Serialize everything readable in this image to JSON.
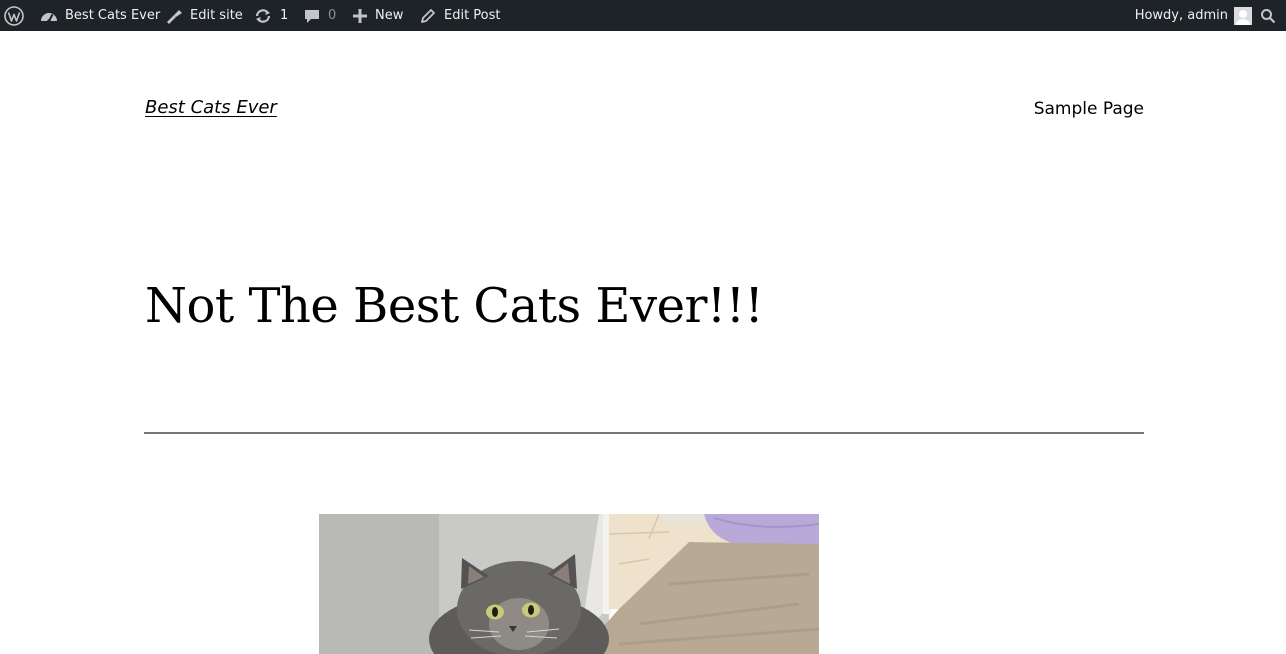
{
  "adminbar": {
    "site_name": "Best Cats Ever",
    "edit_site": "Edit site",
    "updates_count": "1",
    "comments_count": "0",
    "new_label": "New",
    "edit_post": "Edit Post",
    "greeting": "Howdy, admin",
    "icons": {
      "logo": "wordpress-logo-icon",
      "site": "dashboard-icon",
      "edit_site": "brush-icon",
      "updates": "refresh-icon",
      "comments": "comment-bubble-icon",
      "new": "plus-icon",
      "edit_post": "pencil-icon",
      "search": "search-icon"
    },
    "colors": {
      "background": "#1d2327",
      "text": "#f0f0f1",
      "muted": "#8c8f94"
    }
  },
  "site": {
    "title": "Best Cats Ever",
    "nav": [
      "Sample Page"
    ]
  },
  "post": {
    "title": "Not The Best Cats Ever!!!",
    "featured_image_alt": "Gray long-haired cat lying on a carpet"
  }
}
